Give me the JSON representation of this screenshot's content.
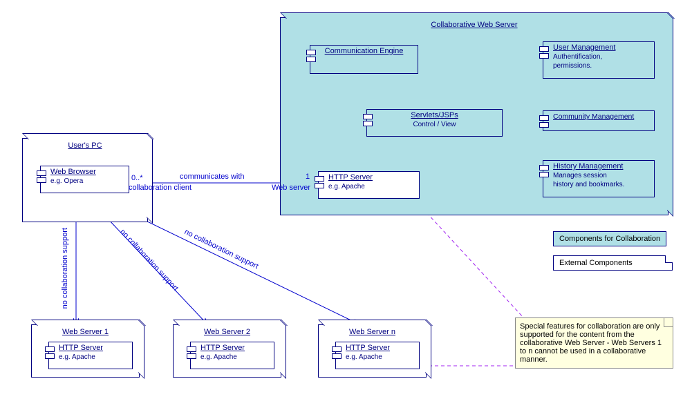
{
  "userPC": {
    "title": "User's PC"
  },
  "webBrowser": {
    "title": "Web Browser",
    "body": "e.g. Opera"
  },
  "collabServer": {
    "title": "Collaborative Web Server"
  },
  "commEngine": {
    "title": "Communication Engine"
  },
  "servlets": {
    "title": "Servlets/JSPs",
    "body": "Control / View"
  },
  "httpCollab": {
    "title": "HTTP Server",
    "body": "e.g. Apache"
  },
  "userMgmt": {
    "title": "User Management",
    "body1": "Authentification,",
    "body2": "permissions."
  },
  "commMgmt": {
    "title": "Community Management"
  },
  "histMgmt": {
    "title": "History Management",
    "body1": "Manages session",
    "body2": "history and bookmarks."
  },
  "ws1": {
    "title": "Web Server 1",
    "http": "HTTP Server",
    "body": "e.g. Apache"
  },
  "ws2": {
    "title": "Web Server 2",
    "http": "HTTP Server",
    "body": "e.g. Apache"
  },
  "wsn": {
    "title": "Web Server n",
    "http": "HTTP Server",
    "body": "e.g. Apache"
  },
  "labels": {
    "mult0": "0..*",
    "mult1": "1",
    "commWith": "communicates with",
    "collabClient": "collaboration client",
    "webServerRole": "Web server",
    "noCollab": "no collaboration support"
  },
  "legend": {
    "collab": "Components for Collaboration",
    "external": "External Components"
  },
  "note": {
    "text": "Special features for collaboration are only supported for the content from the collaborative Web Server - Web Servers 1 to n cannot be used in a collaborative manner."
  }
}
